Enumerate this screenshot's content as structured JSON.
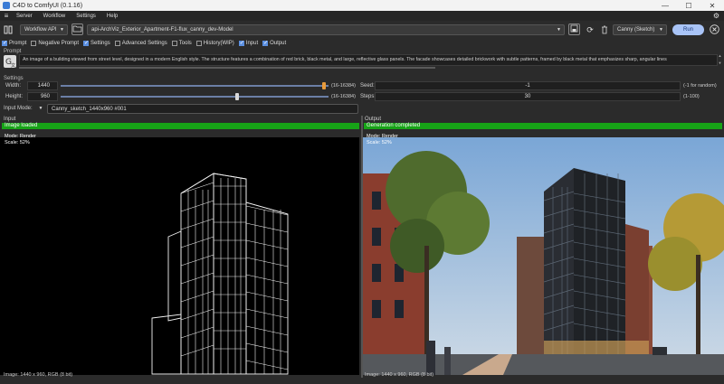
{
  "window": {
    "title": "C4D to ComfyUI (0.1.16)",
    "controls": [
      "—",
      "☐",
      "✕"
    ]
  },
  "menu": {
    "items": [
      "Server",
      "Workflow",
      "Settings",
      "Help"
    ]
  },
  "toolbar": {
    "workflow_mode": "Workflow API",
    "workflow_file": "api-ArchViz_Exterior_Apartment-F1-flux_canny_dev-Model",
    "control_mode": "Canny (Sketch)",
    "run_label": "Run"
  },
  "toggles": [
    {
      "label": "Prompt",
      "checked": true
    },
    {
      "label": "Negative Prompt",
      "checked": false
    },
    {
      "label": "Settings",
      "checked": true
    },
    {
      "label": "Advanced Settings",
      "checked": false
    },
    {
      "label": "Tools",
      "checked": false
    },
    {
      "label": "History(WIP)",
      "checked": false
    },
    {
      "label": "Input",
      "checked": true
    },
    {
      "label": "Output",
      "checked": true
    }
  ],
  "prompt": {
    "label": "Prompt",
    "text": "An image of a building viewed from street level, designed in a modern English style. The structure features a combination of red brick, black metal, and large, reflective glass panels. The facade showcases detailed brickwork with subtle patterns, framed by black metal that emphasizes sharp, angular lines"
  },
  "settings": {
    "label": "Settings",
    "width": {
      "label": "Width:",
      "value": "1440",
      "range": "(16-16384)",
      "fraction": 0.99
    },
    "height": {
      "label": "Height:",
      "value": "960",
      "range": "(16-16384)",
      "fraction": 0.66
    },
    "seed": {
      "label": "Seed:",
      "value": "-1",
      "hint": "(-1 for random)"
    },
    "steps": {
      "label": "Steps:",
      "value": "30",
      "hint": "(1-100)"
    }
  },
  "input_mode": {
    "label": "Input Mode:",
    "value": "Canny_sketch_1440x960 #001"
  },
  "input_panel": {
    "header": "Input",
    "status": "Image loaded",
    "mode": "Mode: Render",
    "scale": "Scale: 52%",
    "footer": "Image: 1440 x 960, RGB (8 bit)"
  },
  "output_panel": {
    "header": "Output",
    "status": "Generation completed",
    "mode": "Mode: Render",
    "scale": "Scale: 52%",
    "footer": "Image: 1440 x 960, RGB (8 bit)"
  },
  "colors": {
    "status_green": "#17a317",
    "run_button": "#a9c4f7",
    "checkbox_on": "#5b8fe0"
  }
}
